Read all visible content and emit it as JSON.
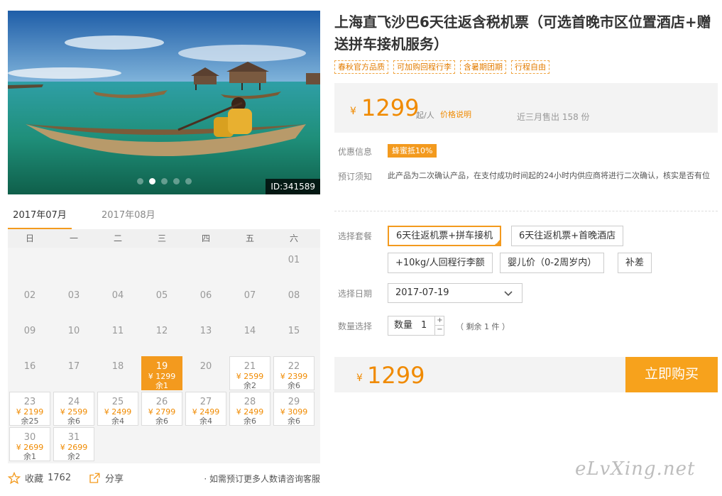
{
  "hero": {
    "image_id": "ID:341589",
    "dots": 5,
    "active_dot": 1
  },
  "calendar": {
    "tabs": [
      {
        "label": "2017年07月",
        "active": true
      },
      {
        "label": "2017年08月",
        "active": false
      }
    ],
    "weekdays": [
      "日",
      "一",
      "二",
      "三",
      "四",
      "五",
      "六"
    ],
    "leading_blanks": 6,
    "days": [
      {
        "d": "01"
      },
      {
        "d": "02"
      },
      {
        "d": "03"
      },
      {
        "d": "04"
      },
      {
        "d": "05"
      },
      {
        "d": "06"
      },
      {
        "d": "07"
      },
      {
        "d": "08"
      },
      {
        "d": "09"
      },
      {
        "d": "10"
      },
      {
        "d": "11"
      },
      {
        "d": "12"
      },
      {
        "d": "13"
      },
      {
        "d": "14"
      },
      {
        "d": "15"
      },
      {
        "d": "16"
      },
      {
        "d": "17"
      },
      {
        "d": "18"
      },
      {
        "d": "19",
        "price": "¥ 1299",
        "stock": "余1",
        "selected": true
      },
      {
        "d": "20"
      },
      {
        "d": "21",
        "price": "¥ 2599",
        "stock": "余2"
      },
      {
        "d": "22",
        "price": "¥ 2399",
        "stock": "余6"
      },
      {
        "d": "23",
        "price": "¥ 2199",
        "stock": "余25"
      },
      {
        "d": "24",
        "price": "¥ 2599",
        "stock": "余6"
      },
      {
        "d": "25",
        "price": "¥ 2499",
        "stock": "余4"
      },
      {
        "d": "26",
        "price": "¥ 2799",
        "stock": "余6"
      },
      {
        "d": "27",
        "price": "¥ 2499",
        "stock": "余4"
      },
      {
        "d": "28",
        "price": "¥ 2499",
        "stock": "余6"
      },
      {
        "d": "29",
        "price": "¥ 3099",
        "stock": "余6"
      },
      {
        "d": "30",
        "price": "¥ 2699",
        "stock": "余1"
      },
      {
        "d": "31",
        "price": "¥ 2699",
        "stock": "余2"
      }
    ]
  },
  "footer": {
    "favorite_label": "收藏",
    "favorite_count": "1762",
    "share_label": "分享",
    "consult_text": "如需预订更多人数请咨询客服"
  },
  "product": {
    "title": "上海直飞沙巴6天往返含税机票（可选首晚市区位置酒店+赠送拼车接机服务）",
    "tags": [
      "春秋官方品质",
      "可加购回程行李",
      "含暑期团期",
      "行程自由"
    ],
    "currency": "¥",
    "price": "1299",
    "per_unit": "起/人",
    "price_explain": "价格说明",
    "sold": "近三月售出 158 份"
  },
  "info": {
    "promo_label": "优惠信息",
    "promo_badge": "蜂蜜抵10%",
    "notice_label": "预订须知",
    "notice_text": "此产品为二次确认产品，在支付成功时间起的24小时内供应商将进行二次确认，核实是否有位"
  },
  "booking": {
    "package_label": "选择套餐",
    "packages": [
      {
        "label": "6天往返机票+拼车接机",
        "selected": true
      },
      {
        "label": "6天往返机票+首晚酒店",
        "selected": false
      },
      {
        "label": "+10kg/人回程行李额",
        "selected": false
      },
      {
        "label": "婴儿价（0-2周岁内）",
        "selected": false
      },
      {
        "label": "补差",
        "selected": false
      }
    ],
    "date_label": "选择日期",
    "date_value": "2017-07-19",
    "qty_label": "数量选择",
    "qty_inner_label": "数量",
    "qty_value": "1",
    "qty_plus": "+",
    "qty_minus": "−",
    "remain": "（ 剩余 1 件 ）"
  },
  "buy": {
    "currency": "¥",
    "price": "1299",
    "button": "立即购买"
  },
  "watermark": "eLvXing.net",
  "colors": {
    "accent": "#f39a1e",
    "price": "#f08a00",
    "panel_bg": "#f3f3f3"
  }
}
